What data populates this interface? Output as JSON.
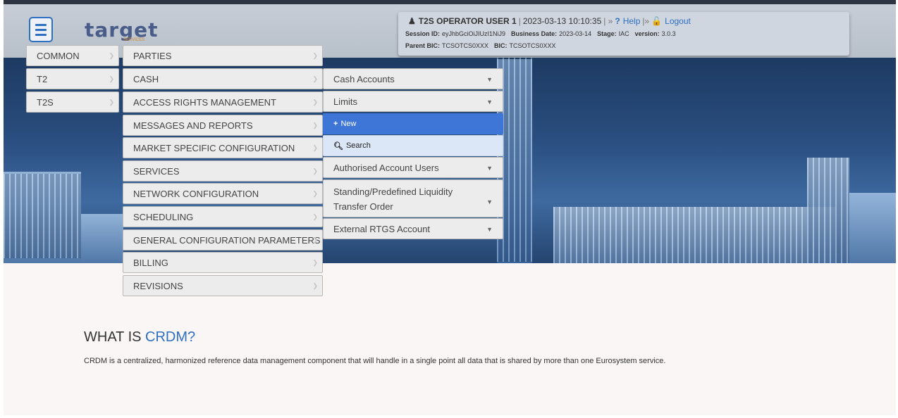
{
  "header": {
    "logo_text": "target",
    "logo_sub": "SERVICES",
    "session": {
      "user": "T2S OPERATOR USER 1",
      "datetime": "2023-03-13 10:10:35",
      "help": "Help",
      "logout": "Logout",
      "session_id_label": "Session ID:",
      "session_id": "eyJhbGciOiJIUzI1NiJ9",
      "business_date_label": "Business Date:",
      "business_date": "2023-03-14",
      "stage_label": "Stage:",
      "stage": "IAC",
      "version_label": "version:",
      "version": "3.0.3",
      "parent_bic_label": "Parent BIC:",
      "parent_bic": "TCSOTCS0XXX",
      "bic_label": "BIC:",
      "bic": "TCSOTCS0XXX"
    }
  },
  "menu_level1": [
    {
      "label": "COMMON"
    },
    {
      "label": "T2"
    },
    {
      "label": "T2S"
    }
  ],
  "menu_level2": [
    {
      "label": "PARTIES"
    },
    {
      "label": "CASH"
    },
    {
      "label": "ACCESS RIGHTS MANAGEMENT"
    },
    {
      "label": "MESSAGES AND REPORTS"
    },
    {
      "label": "MARKET SPECIFIC CONFIGURATION"
    },
    {
      "label": "SERVICES"
    },
    {
      "label": "NETWORK CONFIGURATION"
    },
    {
      "label": "SCHEDULING"
    },
    {
      "label": "GENERAL CONFIGURATION PARAMETERS"
    },
    {
      "label": "BILLING"
    },
    {
      "label": "REVISIONS"
    }
  ],
  "menu_level3": {
    "cash_accounts": "Cash Accounts",
    "limits": "Limits",
    "new": "New",
    "search": "Search",
    "authorised_users": "Authorised Account Users",
    "standing_line1": "Standing/Predefined Liquidity",
    "standing_line2": "Transfer Order",
    "external_rtgs": "External RTGS Account"
  },
  "content": {
    "heading_prefix": "WHAT IS ",
    "heading_highlight": "CRDM?",
    "description": "CRDM is a centralized, harmonized reference data management component that will handle in a single point all data that is shared by more than one Eurosystem service."
  }
}
